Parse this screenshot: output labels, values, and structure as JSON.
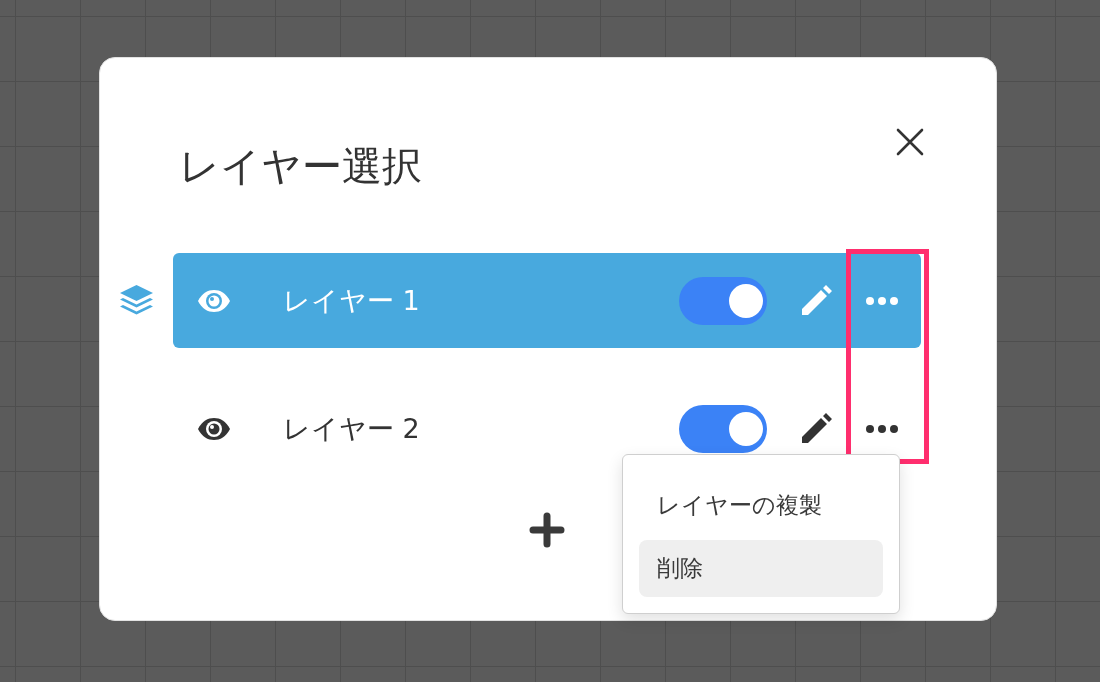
{
  "dialog": {
    "title": "レイヤー選択"
  },
  "layers": [
    {
      "name": "レイヤー 1",
      "selected": true,
      "on": true
    },
    {
      "name": "レイヤー 2",
      "selected": false,
      "on": true,
      "menu": [
        {
          "label": "レイヤーの複製",
          "selected": false
        },
        {
          "label": "削除",
          "selected": true
        }
      ]
    }
  ],
  "highlight_more_buttons": true
}
